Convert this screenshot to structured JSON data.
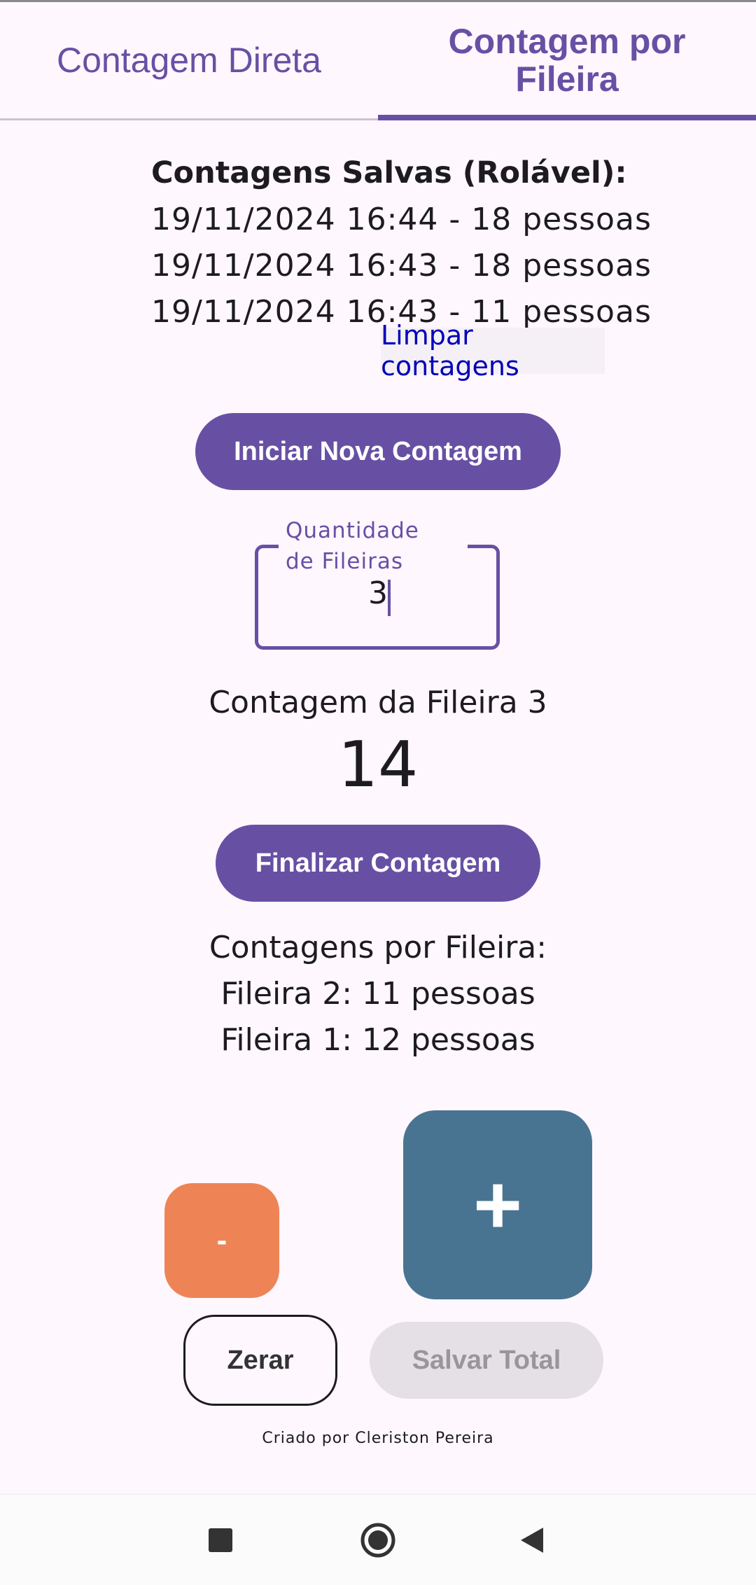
{
  "tabs": [
    {
      "label": "Contagem Direta",
      "selected": false
    },
    {
      "label": "Contagem por Fileira",
      "selected": true
    }
  ],
  "saved": {
    "title": "Contagens Salvas (Rolável):",
    "items": [
      "19/11/2024 16:44 - 18 pessoas",
      "19/11/2024 16:43 - 18 pessoas",
      "19/11/2024 16:43 - 11 pessoas"
    ],
    "clear_label": "Limpar contagens"
  },
  "start_button": "Iniciar Nova Contagem",
  "rows_input": {
    "label": "Quantidade de Fileiras",
    "value": "3"
  },
  "current_row": {
    "heading": "Contagem da Fileira 3",
    "count": "14"
  },
  "finish_button": "Finalizar Contagem",
  "row_counts": {
    "title": "Contagens por Fileira:",
    "items": [
      "Fileira 2: 11 pessoas",
      "Fileira 1: 12 pessoas"
    ]
  },
  "counter": {
    "minus_label": "-",
    "plus_label": "+",
    "reset_label": "Zerar",
    "save_total_label": "Salvar Total"
  },
  "credit": "Criado por Cleriston Pereira",
  "colors": {
    "accent": "#6750a4",
    "minus": "#ee8456",
    "plus": "#497491",
    "link": "#0000b8"
  },
  "nav": {
    "icons": [
      "recents-icon",
      "home-icon",
      "back-icon"
    ]
  }
}
